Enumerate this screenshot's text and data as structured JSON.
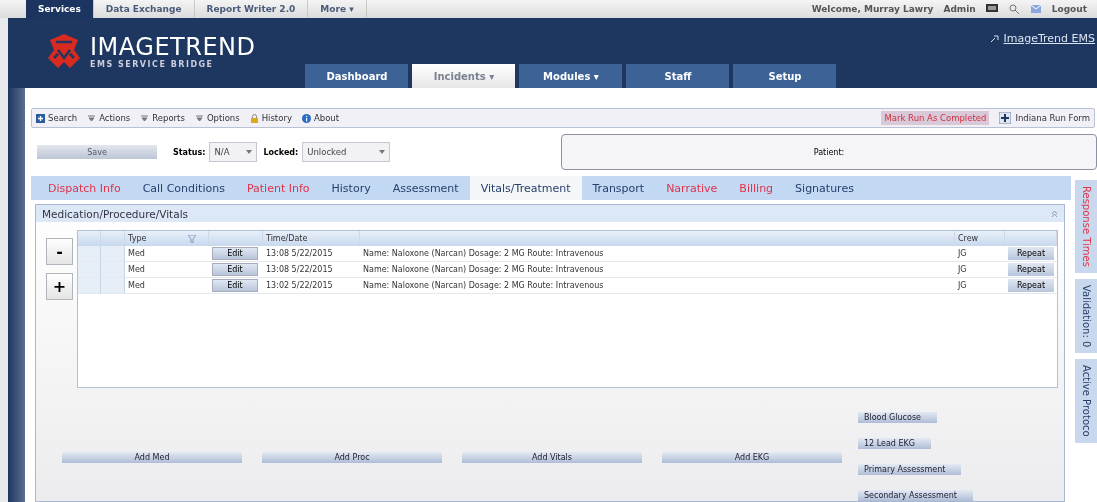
{
  "top_tabs": [
    {
      "label": "Services",
      "selected": true
    },
    {
      "label": "Data Exchange",
      "selected": false
    },
    {
      "label": "Report Writer 2.0",
      "selected": false
    },
    {
      "label": "More ▾",
      "selected": false
    }
  ],
  "user_bar": {
    "welcome": "Welcome, Murray Lawry",
    "admin": "Admin",
    "logout": "Logout"
  },
  "logo": {
    "title": "IMAGETREND",
    "subtitle": "EMS SERVICE BRIDGE"
  },
  "header_link": "ImageTrend EMS",
  "nav_tabs": [
    {
      "label": "Dashboard",
      "selected": false
    },
    {
      "label": "Incidents ▾",
      "selected": true
    },
    {
      "label": "Modules ▾",
      "selected": false
    },
    {
      "label": "Staff",
      "selected": false
    },
    {
      "label": "Setup",
      "selected": false
    }
  ],
  "toolbar": [
    {
      "label": "Search",
      "kind": "search"
    },
    {
      "label": "Actions",
      "kind": "menu"
    },
    {
      "label": "Reports",
      "kind": "menu"
    },
    {
      "label": "Options",
      "kind": "menu"
    },
    {
      "label": "History",
      "kind": "lock"
    },
    {
      "label": "About",
      "kind": "info"
    }
  ],
  "mark_completed": "Mark Run As Completed",
  "run_form": "Indiana Run Form",
  "save": "Save",
  "status": {
    "label": "Status:",
    "value": "N/A"
  },
  "locked": {
    "label": "Locked:",
    "value": "Unlocked"
  },
  "patient_label": "Patient:",
  "form_tabs": [
    {
      "label": "Dispatch Info",
      "color": "#e0334a",
      "selected": false
    },
    {
      "label": "Call Conditions",
      "color": "#27406e",
      "selected": false
    },
    {
      "label": "Patient Info",
      "color": "#e0334a",
      "selected": false
    },
    {
      "label": "History",
      "color": "#27406e",
      "selected": false
    },
    {
      "label": "Assessment",
      "color": "#27406e",
      "selected": false
    },
    {
      "label": "Vitals/Treatment",
      "color": "#27406e",
      "selected": true
    },
    {
      "label": "Transport",
      "color": "#27406e",
      "selected": false
    },
    {
      "label": "Narrative",
      "color": "#e0334a",
      "selected": false
    },
    {
      "label": "Billing",
      "color": "#e0334a",
      "selected": false
    },
    {
      "label": "Signatures",
      "color": "#27406e",
      "selected": false
    }
  ],
  "side_tabs": [
    {
      "label": "Response Times",
      "color": "#e0334a"
    },
    {
      "label": "Validation: 0",
      "color": "#27406e"
    },
    {
      "label": "Active Protoco",
      "color": "#27406e"
    }
  ],
  "panel_title": "Medication/Procedure/Vitals",
  "grid": {
    "columns": {
      "type": "Type",
      "time": "Time/Date",
      "crew": "Crew"
    },
    "rows": [
      {
        "type": "Med",
        "edit": "Edit",
        "time": "13:08 5/22/2015",
        "details": "Name: Naloxone (Narcan) Dosage: 2 MG Route: Intravenous",
        "crew": "JG",
        "repeat": "Repeat"
      },
      {
        "type": "Med",
        "edit": "Edit",
        "time": "13:08 5/22/2015",
        "details": "Name: Naloxone (Narcan) Dosage: 2 MG Route: Intravenous",
        "crew": "JG",
        "repeat": "Repeat"
      },
      {
        "type": "Med",
        "edit": "Edit",
        "time": "13:02 5/22/2015",
        "details": "Name: Naloxone (Narcan) Dosage: 2 MG Route: Intravenous",
        "crew": "JG",
        "repeat": "Repeat"
      }
    ]
  },
  "side_buttons": [
    "-",
    "+"
  ],
  "add_buttons": [
    "Add Med",
    "Add Proc",
    "Add Vitals",
    "Add EKG"
  ],
  "quick_buttons": [
    "Blood Glucose",
    "12 Lead EKG",
    "Primary Assessment",
    "Secondary Assessment"
  ]
}
